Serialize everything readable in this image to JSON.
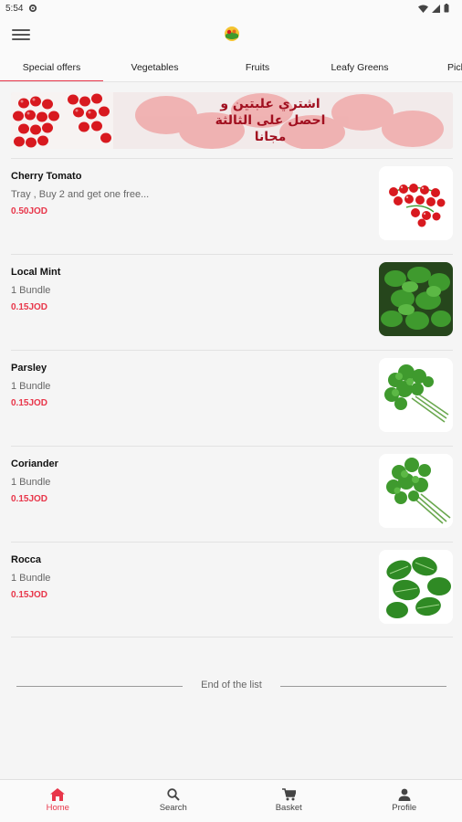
{
  "status_bar": {
    "time": "5:54"
  },
  "tabs": [
    {
      "label": "Special offers",
      "active": true
    },
    {
      "label": "Vegetables",
      "active": false
    },
    {
      "label": "Fruits",
      "active": false
    },
    {
      "label": "Leafy Greens",
      "active": false
    },
    {
      "label": "Pick",
      "active": false
    }
  ],
  "banner": {
    "lines": [
      "اشتري علبتين و",
      "احصل على الثالثة",
      "مجانا"
    ]
  },
  "products": [
    {
      "name": "Cherry Tomato",
      "desc": "Tray , Buy 2 and get one free...",
      "price": "0.50JOD",
      "image": "cherry-tomato"
    },
    {
      "name": "Local Mint",
      "desc": "1 Bundle",
      "price": "0.15JOD",
      "image": "mint"
    },
    {
      "name": "Parsley",
      "desc": "1 Bundle",
      "price": "0.15JOD",
      "image": "parsley"
    },
    {
      "name": "Coriander",
      "desc": "1 Bundle",
      "price": "0.15JOD",
      "image": "coriander"
    },
    {
      "name": "Rocca",
      "desc": "1 Bundle",
      "price": "0.15JOD",
      "image": "rocca"
    }
  ],
  "end_of_list": "End of the list",
  "bottom_nav": [
    {
      "label": "Home",
      "icon": "home-icon",
      "active": true
    },
    {
      "label": "Search",
      "icon": "search-icon",
      "active": false
    },
    {
      "label": "Basket",
      "icon": "cart-icon",
      "active": false
    },
    {
      "label": "Profile",
      "icon": "person-icon",
      "active": false
    }
  ],
  "colors": {
    "accent": "#e8364a",
    "background": "#f5f5f5",
    "leaf_green": "#3f9a2e",
    "tomato_red": "#d8191f"
  }
}
